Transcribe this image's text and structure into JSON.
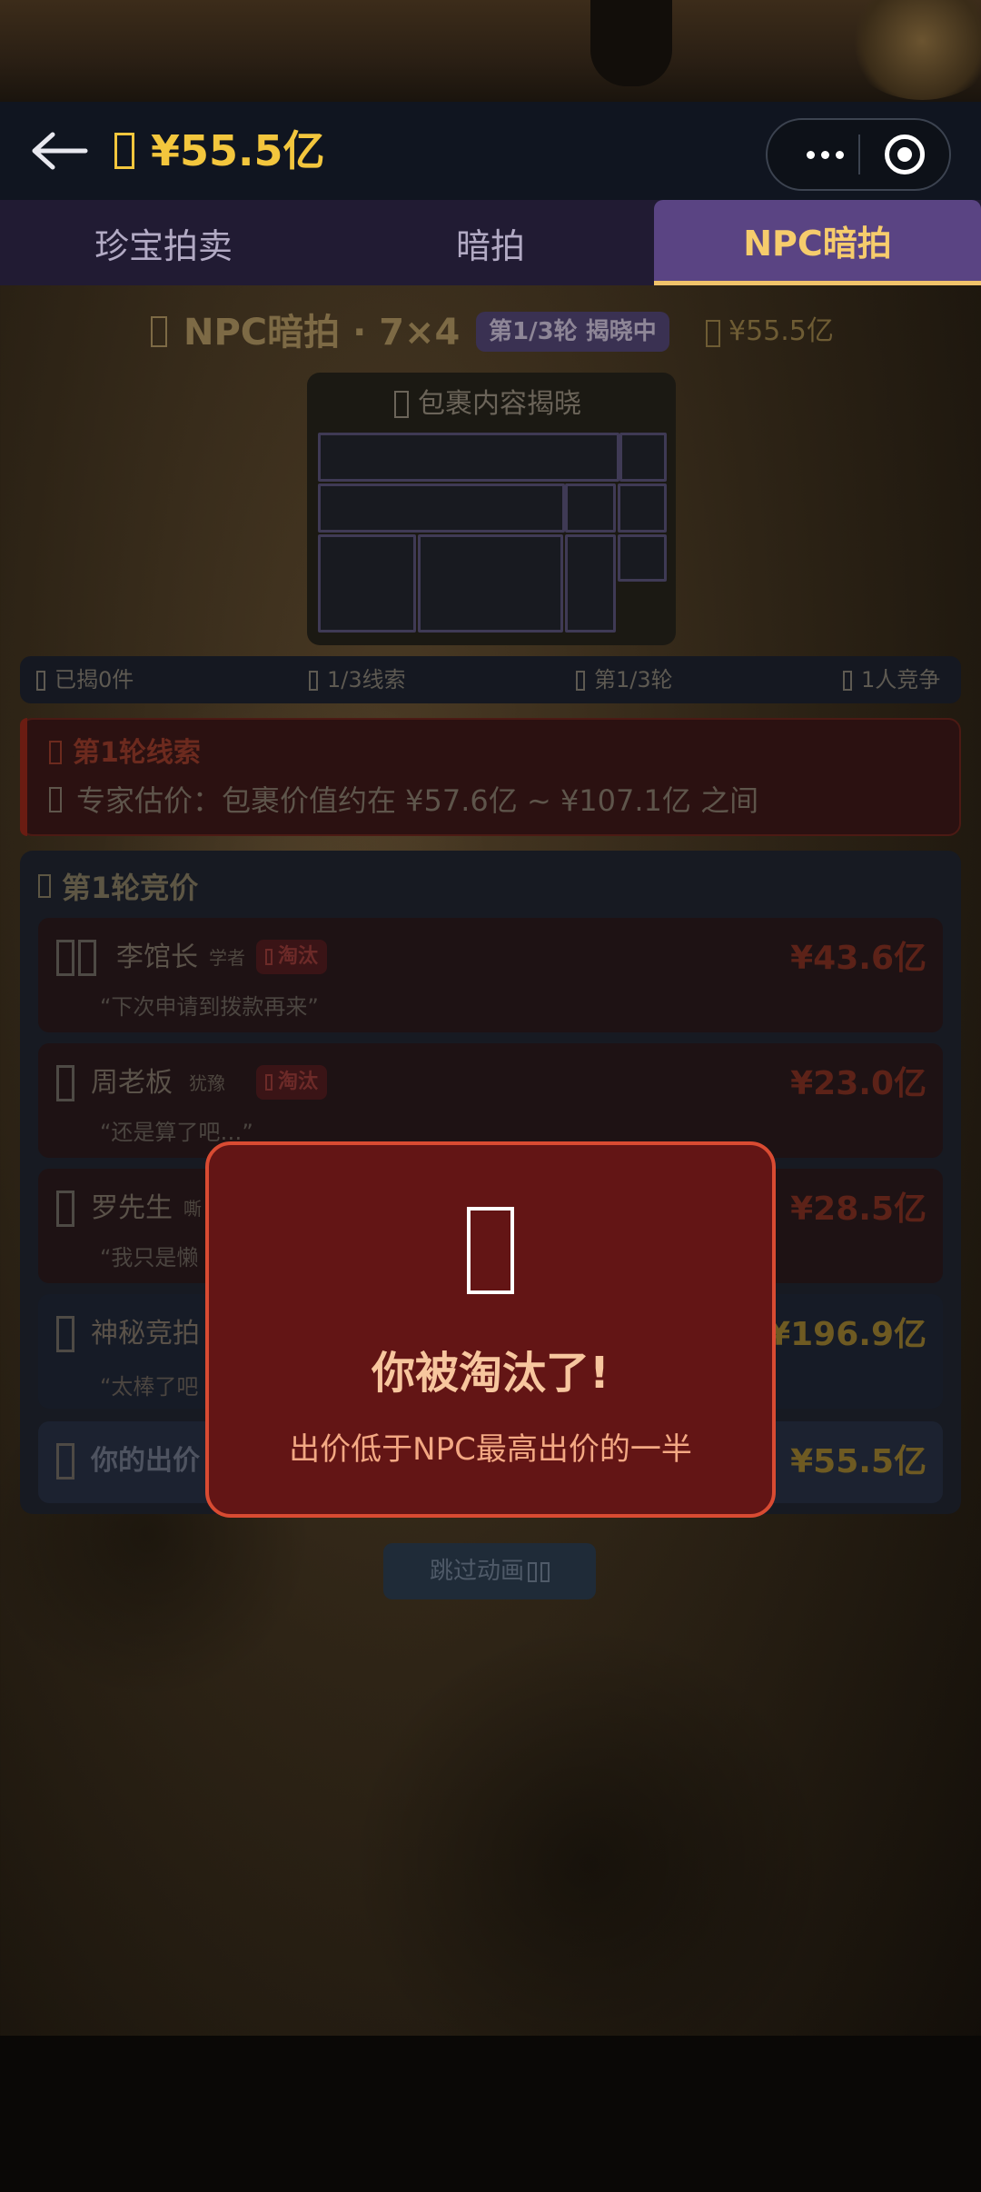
{
  "header": {
    "balance": "¥55.5亿"
  },
  "tabs": [
    {
      "label": "珍宝拍卖",
      "active": false
    },
    {
      "label": "暗拍",
      "active": false
    },
    {
      "label": "NPC暗拍",
      "active": true
    }
  ],
  "game": {
    "title": "NPC暗拍 · 7×4",
    "round_badge": "第1/3轮 揭晓中",
    "cash": "¥55.5亿",
    "package_label": "包裹内容揭晓",
    "stats": [
      "已揭0件",
      "1/3线索",
      "第1/3轮",
      "1人竞争"
    ],
    "clue": {
      "title": "第1轮线索",
      "text": "专家估价：包裹价值约在 ¥57.6亿 ~ ¥107.1亿 之间"
    },
    "bids_title": "第1轮竞价",
    "bidders": [
      {
        "name": "李馆长",
        "tag": "学者",
        "status": "淘汰",
        "price": "¥43.6亿",
        "quote": "“下次申请到拨款再来”"
      },
      {
        "name": "周老板",
        "tag": "犹豫",
        "status": "淘汰",
        "price": "¥23.0亿",
        "quote": "“还是算了吧…”"
      },
      {
        "name": "罗先生",
        "tag": "嘶",
        "status": "",
        "price": "¥28.5亿",
        "quote": "“我只是懒"
      },
      {
        "name": "神秘竞拍",
        "tag": "",
        "status": "",
        "price": "¥196.9亿",
        "quote": "“太棒了吧"
      },
      {
        "name": "你的出价",
        "tag": "",
        "status": "",
        "price": "¥55.5亿",
        "quote": ""
      }
    ],
    "skip_label": "跳过动画"
  },
  "modal": {
    "title": "你被淘汰了!",
    "subtitle": "出价低于NPC最高出价的一半"
  },
  "colors": {
    "gold": "#f3c63d",
    "tab_active_bg": "#5a4483",
    "modal_bg": "#631515",
    "modal_border": "#d94b32",
    "eliminated": "#6c2a28"
  }
}
